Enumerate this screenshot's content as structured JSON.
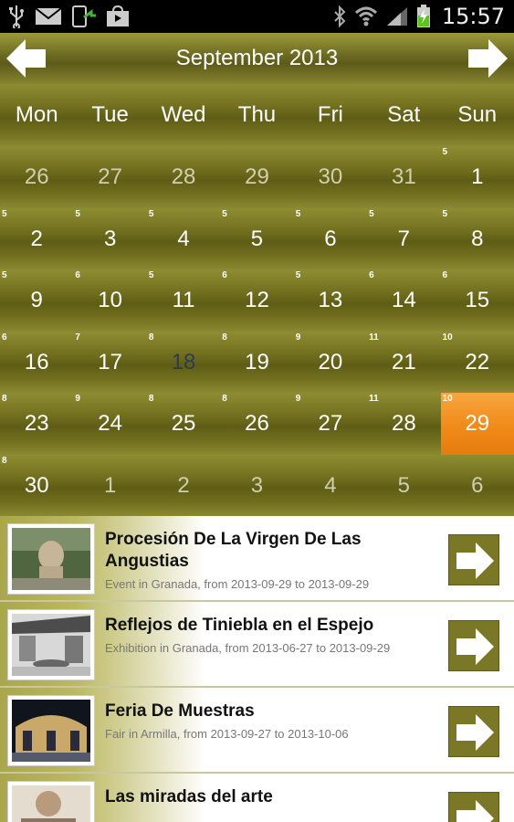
{
  "status_bar": {
    "time": "15:57",
    "icons": [
      "usb-icon",
      "email-icon",
      "download-icon",
      "shopping-bag-icon",
      "bluetooth-icon",
      "wifi-icon",
      "signal-icon",
      "battery-charging-icon"
    ]
  },
  "header": {
    "title": "September 2013",
    "prev_icon": "arrow-left-icon",
    "next_icon": "arrow-right-icon"
  },
  "calendar": {
    "weekdays": [
      "Mon",
      "Tue",
      "Wed",
      "Thu",
      "Fri",
      "Sat",
      "Sun"
    ],
    "weeks": [
      [
        {
          "day": "26",
          "count": "",
          "other": true
        },
        {
          "day": "27",
          "count": "",
          "other": true
        },
        {
          "day": "28",
          "count": "",
          "other": true
        },
        {
          "day": "29",
          "count": "",
          "other": true
        },
        {
          "day": "30",
          "count": "",
          "other": true
        },
        {
          "day": "31",
          "count": "",
          "other": true
        },
        {
          "day": "1",
          "count": "5"
        }
      ],
      [
        {
          "day": "2",
          "count": "5"
        },
        {
          "day": "3",
          "count": "5"
        },
        {
          "day": "4",
          "count": "5"
        },
        {
          "day": "5",
          "count": "5"
        },
        {
          "day": "6",
          "count": "5"
        },
        {
          "day": "7",
          "count": "5"
        },
        {
          "day": "8",
          "count": "5"
        }
      ],
      [
        {
          "day": "9",
          "count": "5"
        },
        {
          "day": "10",
          "count": "6"
        },
        {
          "day": "11",
          "count": "5"
        },
        {
          "day": "12",
          "count": "6"
        },
        {
          "day": "13",
          "count": "5"
        },
        {
          "day": "14",
          "count": "6"
        },
        {
          "day": "15",
          "count": "6"
        }
      ],
      [
        {
          "day": "16",
          "count": "6"
        },
        {
          "day": "17",
          "count": "7"
        },
        {
          "day": "18",
          "count": "8",
          "today": true
        },
        {
          "day": "19",
          "count": "8"
        },
        {
          "day": "20",
          "count": "9"
        },
        {
          "day": "21",
          "count": "11"
        },
        {
          "day": "22",
          "count": "10"
        }
      ],
      [
        {
          "day": "23",
          "count": "8"
        },
        {
          "day": "24",
          "count": "9"
        },
        {
          "day": "25",
          "count": "8"
        },
        {
          "day": "26",
          "count": "8"
        },
        {
          "day": "27",
          "count": "9"
        },
        {
          "day": "28",
          "count": "11"
        },
        {
          "day": "29",
          "count": "10",
          "selected": true
        }
      ],
      [
        {
          "day": "30",
          "count": "8"
        },
        {
          "day": "1",
          "count": "",
          "other": true
        },
        {
          "day": "2",
          "count": "",
          "other": true
        },
        {
          "day": "3",
          "count": "",
          "other": true
        },
        {
          "day": "4",
          "count": "",
          "other": true
        },
        {
          "day": "5",
          "count": "",
          "other": true
        },
        {
          "day": "6",
          "count": "",
          "other": true
        }
      ]
    ]
  },
  "events": [
    {
      "title": "Procesión De La Virgen De Las Angustias",
      "subtitle": "Event in Granada, from 2013-09-29 to 2013-09-29",
      "thumb_icon": "statue-photo-icon",
      "button_icon": "arrow-right-icon"
    },
    {
      "title": "Reflejos de Tiniebla en el Espejo",
      "subtitle": "Exhibition in Granada, from 2013-06-27 to 2013-09-29",
      "thumb_icon": "courtyard-photo-icon",
      "button_icon": "arrow-right-icon"
    },
    {
      "title": "Feria De Muestras",
      "subtitle": "Fair in Armilla, from 2013-09-27 to 2013-10-06",
      "thumb_icon": "fair-photo-icon",
      "button_icon": "arrow-right-icon"
    },
    {
      "title": "Las miradas del arte",
      "subtitle": "",
      "thumb_icon": "art-photo-icon",
      "button_icon": "arrow-right-icon"
    }
  ]
}
